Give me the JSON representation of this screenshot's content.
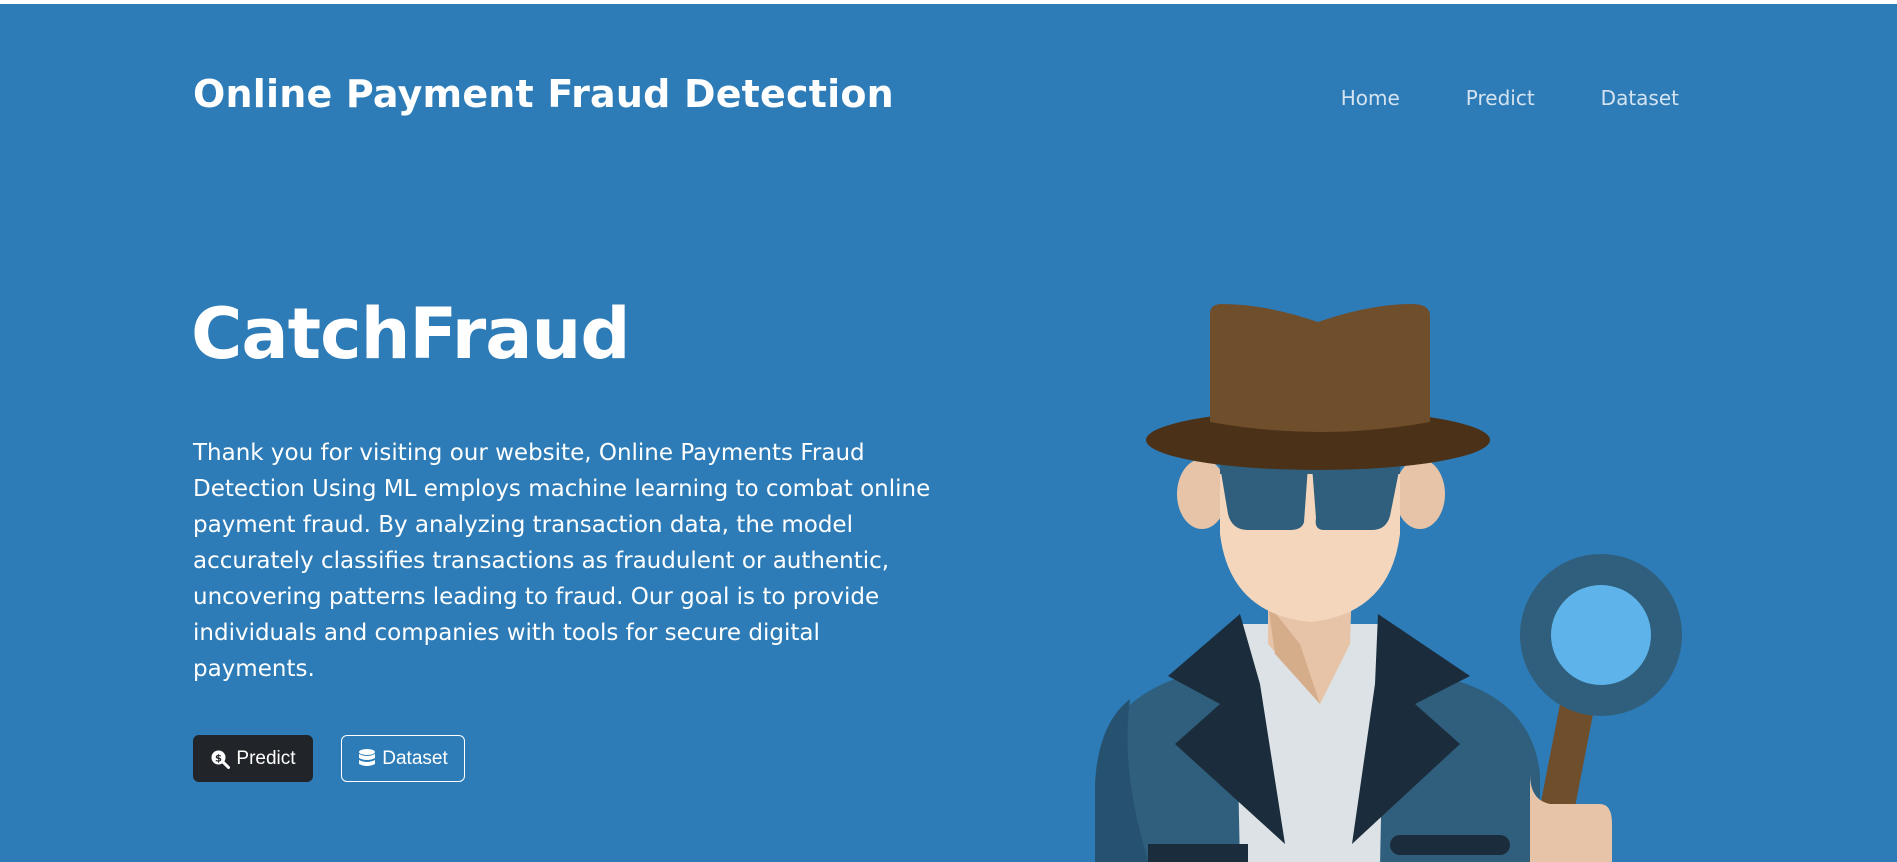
{
  "header": {
    "brand": "Online Payment Fraud Detection",
    "nav": [
      {
        "label": "Home"
      },
      {
        "label": "Predict"
      },
      {
        "label": "Dataset"
      }
    ]
  },
  "hero": {
    "title": "CatchFraud",
    "description": "Thank you for visiting our website, Online Payments Fraud Detection Using ML employs machine learning to combat online payment fraud. By analyzing transaction data, the model accurately classifies transactions as fraudulent or authentic, uncovering patterns leading to fraud. Our goal is to provide individuals and companies with tools for secure digital payments.",
    "buttons": {
      "predict": {
        "label": "Predict",
        "icon": "search-dollar-icon"
      },
      "dataset": {
        "label": "Dataset",
        "icon": "database-icon"
      }
    },
    "illustration": {
      "icon": "detective-illustration"
    }
  },
  "colors": {
    "hero_background": "#2d7cb7",
    "nav_text": "#d4e3f0",
    "primary_button": "#212529",
    "hat_brown": "#6f4e2c",
    "coat": "#2f5f7c",
    "lens": "#5db3ea"
  }
}
